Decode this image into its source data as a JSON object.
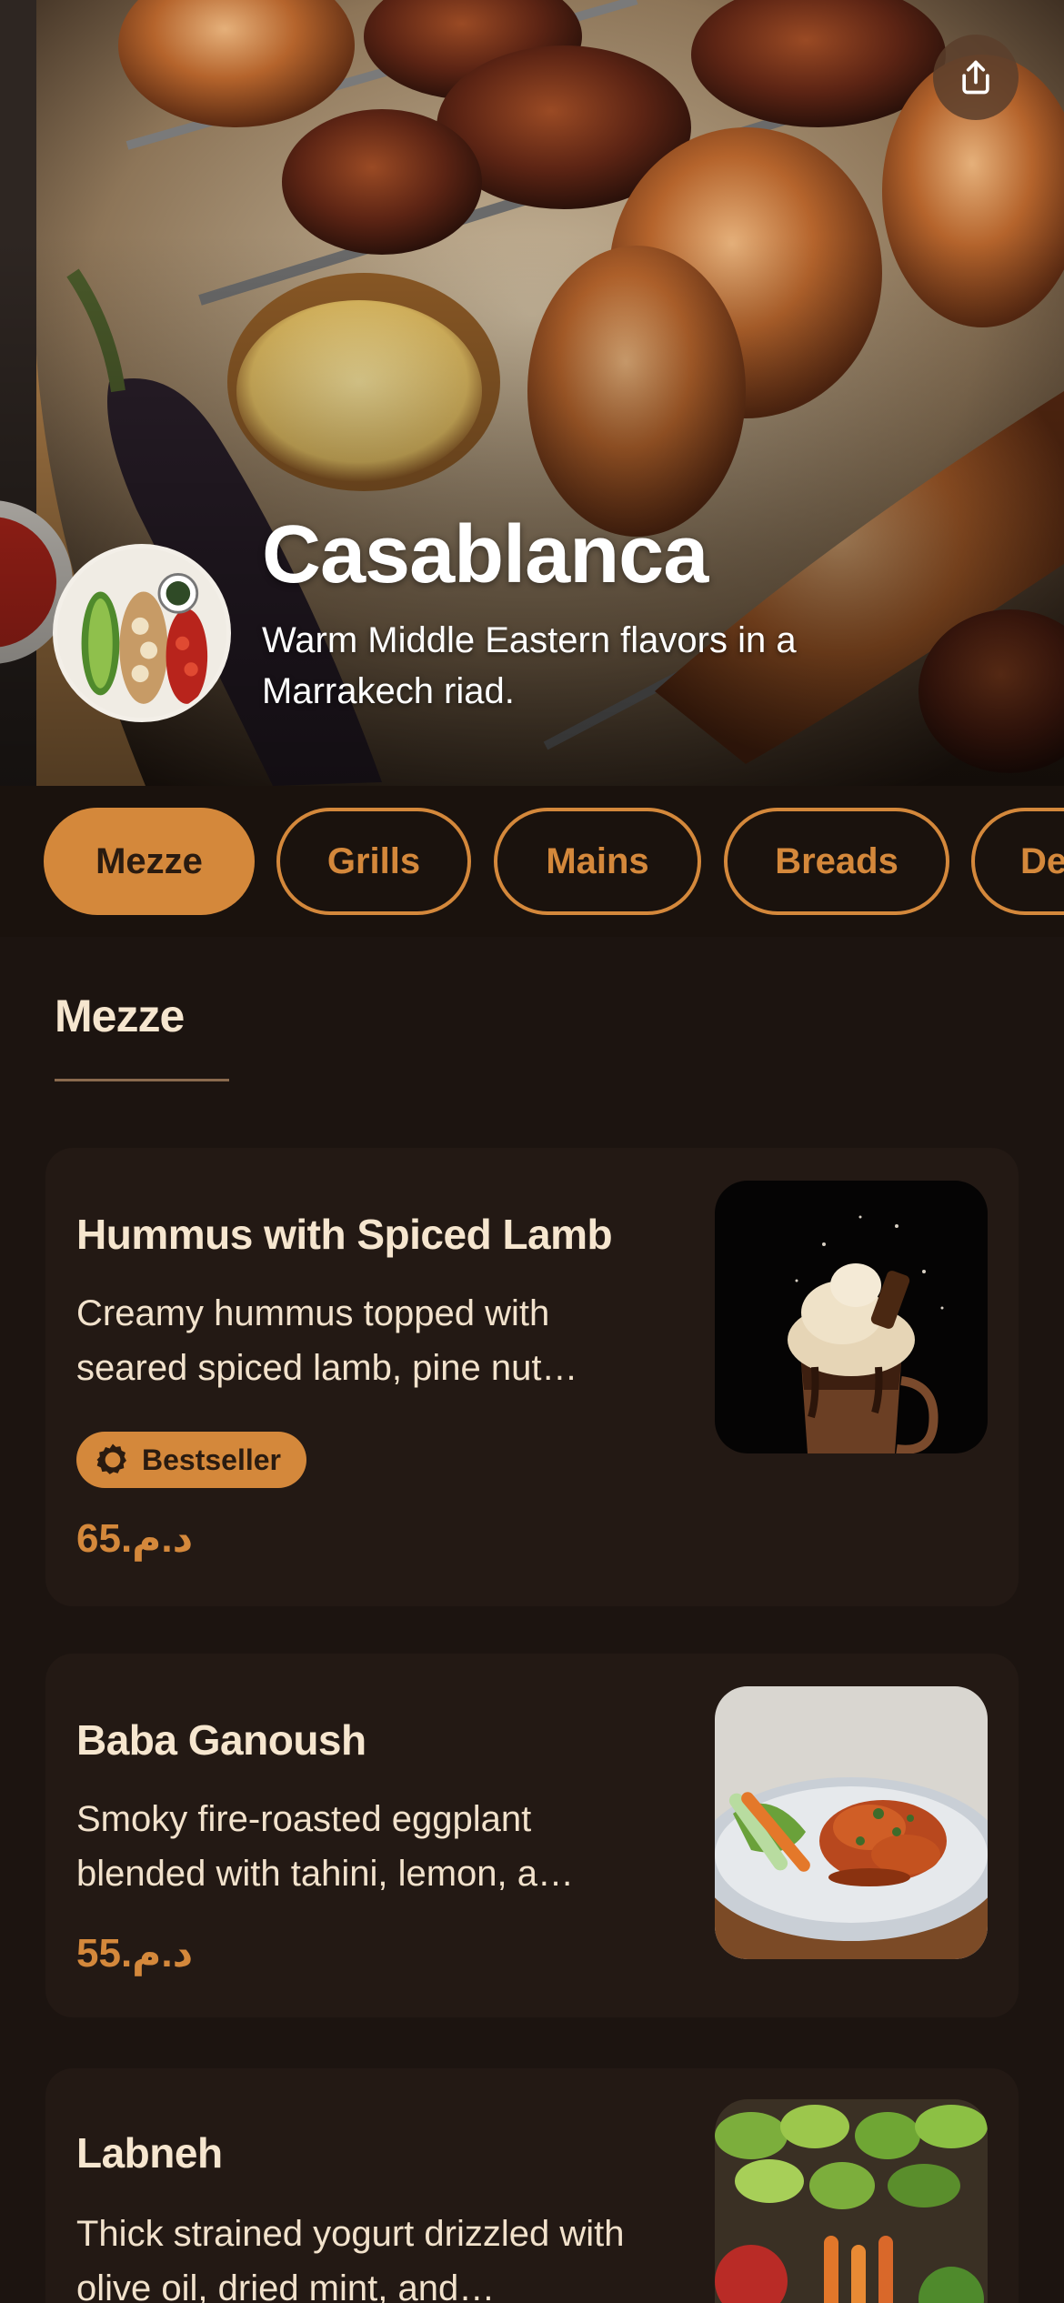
{
  "restaurant": {
    "name": "Casablanca",
    "tagline": "Warm Middle Eastern flavors in a Marrakech riad."
  },
  "header": {
    "share_icon": "share-icon"
  },
  "categories": [
    {
      "label": "Mezze",
      "active": true
    },
    {
      "label": "Grills",
      "active": false
    },
    {
      "label": "Mains",
      "active": false
    },
    {
      "label": "Breads",
      "active": false
    },
    {
      "label": "De",
      "active": false
    }
  ],
  "section": {
    "title": "Mezze"
  },
  "menu_items": [
    {
      "name": "Hummus with Spiced Lamb",
      "description": "Creamy hummus topped with seared spiced lamb, pine nut…",
      "badge": "Bestseller",
      "price": "65.د.م"
    },
    {
      "name": "Baba Ganoush",
      "description": "Smoky fire-roasted eggplant blended with tahini, lemon, a…",
      "price": "55.د.م"
    },
    {
      "name": "Labneh",
      "description": "Thick strained yogurt drizzled with olive oil, dried mint, and…"
    }
  ],
  "colors": {
    "accent": "#d4883b",
    "background": "#1c1410",
    "card": "#231914",
    "text": "#f6e6cf"
  }
}
